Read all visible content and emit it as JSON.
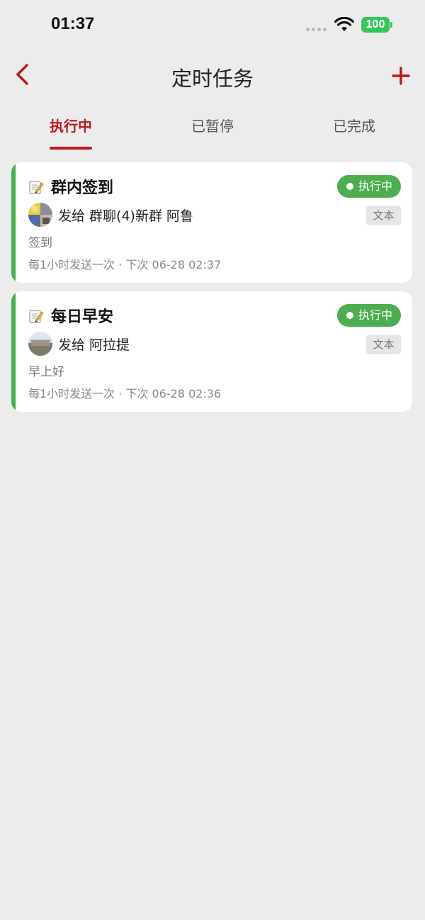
{
  "status_bar": {
    "time": "01:37",
    "battery": "100",
    "icons": [
      "signal-dots-icon",
      "wifi-icon",
      "battery-icon"
    ]
  },
  "nav": {
    "title": "定时任务",
    "back_icon": "chevron-left-icon",
    "add_icon": "plus-icon"
  },
  "tabs": [
    {
      "label": "执行中",
      "active": true
    },
    {
      "label": "已暂停",
      "active": false
    },
    {
      "label": "已完成",
      "active": false
    }
  ],
  "colors": {
    "accent": "#c0181e",
    "status_green": "#4cae4f",
    "background": "#ececec"
  },
  "tasks": [
    {
      "icon": "memo-icon",
      "title": "群内签到",
      "status": "执行中",
      "recipient": "发给 群聊(4)新群 阿鲁",
      "type": "文本",
      "content": "签到",
      "schedule": "每1小时发送一次 · 下次 06-28 02:37"
    },
    {
      "icon": "memo-icon",
      "title": "每日早安",
      "status": "执行中",
      "recipient": "发给 阿拉提",
      "type": "文本",
      "content": "早上好",
      "schedule": "每1小时发送一次 · 下次 06-28 02:36"
    }
  ]
}
